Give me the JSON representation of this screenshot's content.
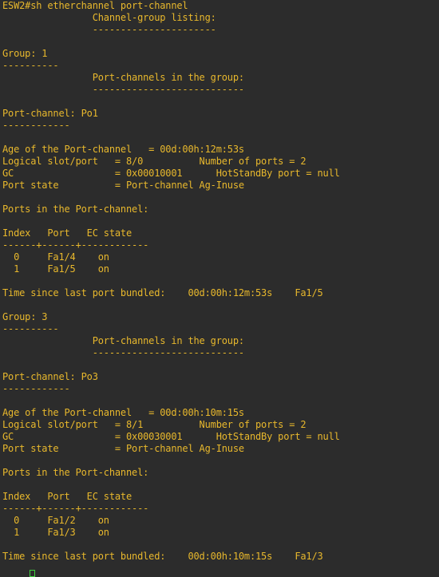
{
  "terminal": {
    "lines": [
      "ESW2#sh etherchannel port-channel",
      "                Channel-group listing:",
      "                ----------------------",
      "",
      "Group: 1",
      "----------",
      "                Port-channels in the group:",
      "                ---------------------------",
      "",
      "Port-channel: Po1",
      "------------",
      "",
      "Age of the Port-channel   = 00d:00h:12m:53s",
      "Logical slot/port   = 8/0          Number of ports = 2",
      "GC                  = 0x00010001      HotStandBy port = null",
      "Port state          = Port-channel Ag-Inuse",
      "",
      "Ports in the Port-channel:",
      "",
      "Index   Port   EC state",
      "------+------+------------",
      "  0     Fa1/4    on",
      "  1     Fa1/5    on",
      "",
      "Time since last port bundled:    00d:00h:12m:53s    Fa1/5",
      "",
      "Group: 3",
      "----------",
      "                Port-channels in the group:",
      "                ---------------------------",
      "",
      "Port-channel: Po3",
      "------------",
      "",
      "Age of the Port-channel   = 00d:00h:10m:15s",
      "Logical slot/port   = 8/1          Number of ports = 2",
      "GC                  = 0x00030001      HotStandBy port = null",
      "Port state          = Port-channel Ag-Inuse",
      "",
      "Ports in the Port-channel:",
      "",
      "Index   Port   EC state",
      "------+------+------------",
      "  0     Fa1/2    on",
      "  1     Fa1/3    on",
      "",
      "Time since last port bundled:    00d:00h:10m:15s    Fa1/3",
      ""
    ]
  }
}
